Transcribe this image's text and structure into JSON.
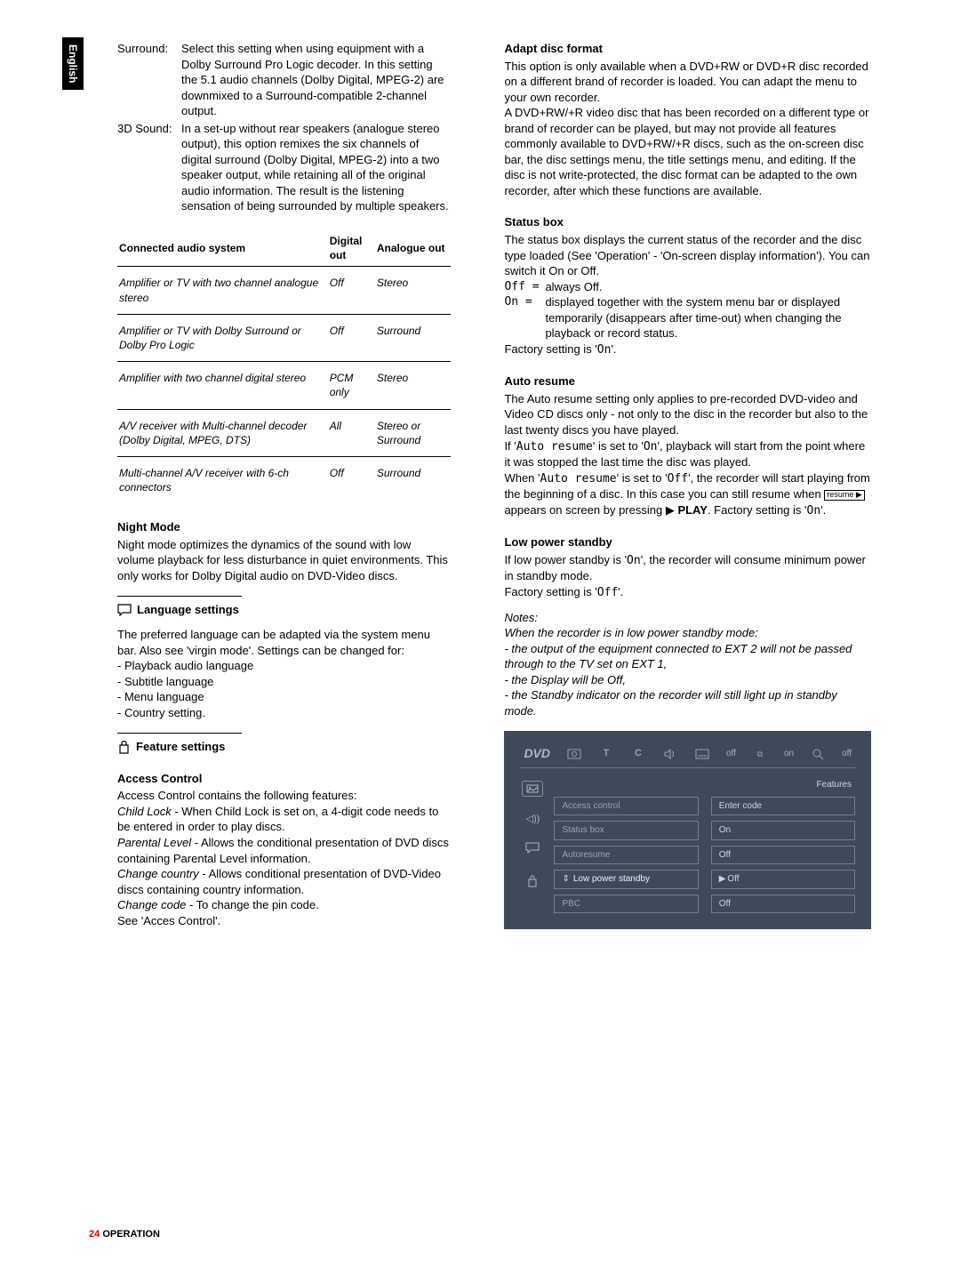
{
  "sidebar": {
    "language": "English"
  },
  "left": {
    "defs": [
      {
        "term": "Surround:",
        "body": "Select this setting when using equipment with a Dolby Surround Pro Logic decoder. In this setting the 5.1 audio channels (Dolby Digital, MPEG-2) are downmixed to a Surround-compatible 2-channel output."
      },
      {
        "term": "3D Sound:",
        "body": "In a set-up without rear speakers (analogue stereo output), this option remixes the six channels of digital surround (Dolby Digital, MPEG-2) into a two speaker output, while retaining all of the original audio information. The result is the listening sensation of being surrounded by multiple speakers."
      }
    ],
    "table": {
      "headers": [
        "Connected audio system",
        "Digital out",
        "Analogue out"
      ],
      "rows": [
        [
          "Amplifier or TV with two channel analogue stereo",
          "Off",
          "Stereo"
        ],
        [
          "Amplifier or TV with Dolby Surround or Dolby Pro Logic",
          "Off",
          "Surround"
        ],
        [
          "Amplifier with two channel digital stereo",
          "PCM only",
          "Stereo"
        ],
        [
          "A/V receiver with Multi-channel decoder (Dolby Digital, MPEG, DTS)",
          "All",
          "Stereo or Surround"
        ],
        [
          "Multi-channel A/V receiver with 6-ch connectors",
          "Off",
          "Surround"
        ]
      ]
    },
    "night": {
      "title": "Night Mode",
      "body": "Night mode optimizes the dynamics of the sound with low volume playback for less disturbance in quiet environments. This only works for Dolby Digital audio on DVD-Video discs."
    },
    "lang": {
      "title": "Language settings",
      "intro": "The preferred language can be adapted via the system menu bar. Also see 'virgin mode'. Settings can be changed for:",
      "items": [
        "- Playback audio language",
        "- Subtitle language",
        "- Menu language",
        "- Country setting."
      ]
    },
    "feat": {
      "title": "Feature settings",
      "access_title": "Access Control",
      "access_intro": "Access Control contains the following features:",
      "lines": [
        {
          "em": "Child Lock",
          "rest": " - When Child Lock is set on, a 4-digit code needs to be entered in order to play discs."
        },
        {
          "em": "Parental Level",
          "rest": " - Allows the conditional presentation of DVD discs containing Parental Level information."
        },
        {
          "em": "Change country",
          "rest": " - Allows conditional presentation of DVD-Video discs containing country information."
        },
        {
          "em": "Change code",
          "rest": " - To change the pin code."
        }
      ],
      "see": "See 'Acces Control'."
    }
  },
  "right": {
    "adapt": {
      "title": "Adapt disc format",
      "p1": "This option is only available when a DVD+RW or DVD+R disc recorded on a different brand of recorder is loaded. You can adapt the menu to your own recorder.",
      "p2": "A DVD+RW/+R video disc that has been recorded on a different type or brand of recorder can be played, but may not provide all features commonly available to DVD+RW/+R discs, such as the on-screen disc bar, the disc settings menu, the title settings menu, and editing. If the disc is not write-protected, the disc format can be adapted to the own recorder, after which these functions are available."
    },
    "status": {
      "title": "Status box",
      "intro": "The status box displays the current status of the recorder and the disc type loaded (See 'Operation' - 'On-screen display information'). You can switch it On or Off.",
      "off_term": "Off =",
      "off_body": "always Off.",
      "on_term": "On =",
      "on_body": "displayed together with the system menu bar or displayed temporarily (disappears after time-out) when changing the playback or record status.",
      "factory_a": "Factory setting is '",
      "factory_b": "On",
      "factory_c": "'."
    },
    "auto": {
      "title": "Auto resume",
      "p1": "The Auto resume setting only applies to pre-recorded DVD-video and Video CD discs only - not only to the disc in the recorder but also to the last twenty discs you have played.",
      "p2a": "If '",
      "p2b": "Auto resume",
      "p2c": "' is set to '",
      "p2d": "On",
      "p2e": "', playback will start from the point where it was stopped the last time the disc was played.",
      "p3a": "When '",
      "p3b": "Auto resume",
      "p3c": "' is set to '",
      "p3d": "Off",
      "p3e": "', the recorder will start playing from the beginning of a disc. In this case you can still resume when ",
      "p3f": " appears on screen by pressing ",
      "p3g": "PLAY",
      "p3h": ". Factory setting is '",
      "p3i": "On",
      "p3j": "'.",
      "kb": "resume ▶"
    },
    "lp": {
      "title": "Low power standby",
      "a": "If low power standby is '",
      "b": "On",
      "c": "', the recorder will consume minimum power in standby mode.",
      "fa": "Factory setting is '",
      "fb": "Off",
      "fc": "'."
    },
    "notes": {
      "title": "Notes:",
      "l1": "When the recorder is in low power standby mode:",
      "l2": "- the output of the equipment connected to EXT 2 will not be passed through to the TV set on EXT 1,",
      "l3": "- the Display will be Off,",
      "l4": "- the Standby indicator on the recorder will still light up in standby mode."
    },
    "osd": {
      "dvd": "DVD",
      "top": [
        "off",
        "on",
        "off"
      ],
      "features": "Features",
      "colA": [
        {
          "label": "Access control",
          "active": false
        },
        {
          "label": "Status box",
          "active": false
        },
        {
          "label": "Autoresume",
          "active": false
        },
        {
          "label": "Low power standby",
          "active": true
        },
        {
          "label": "PBC",
          "active": false
        }
      ],
      "colB": [
        {
          "label": "Enter code"
        },
        {
          "label": "On"
        },
        {
          "label": "Off"
        },
        {
          "label": "Off",
          "cursor": true
        },
        {
          "label": "Off"
        }
      ]
    }
  },
  "footer": {
    "page": "24",
    "section": "OPERATION"
  }
}
